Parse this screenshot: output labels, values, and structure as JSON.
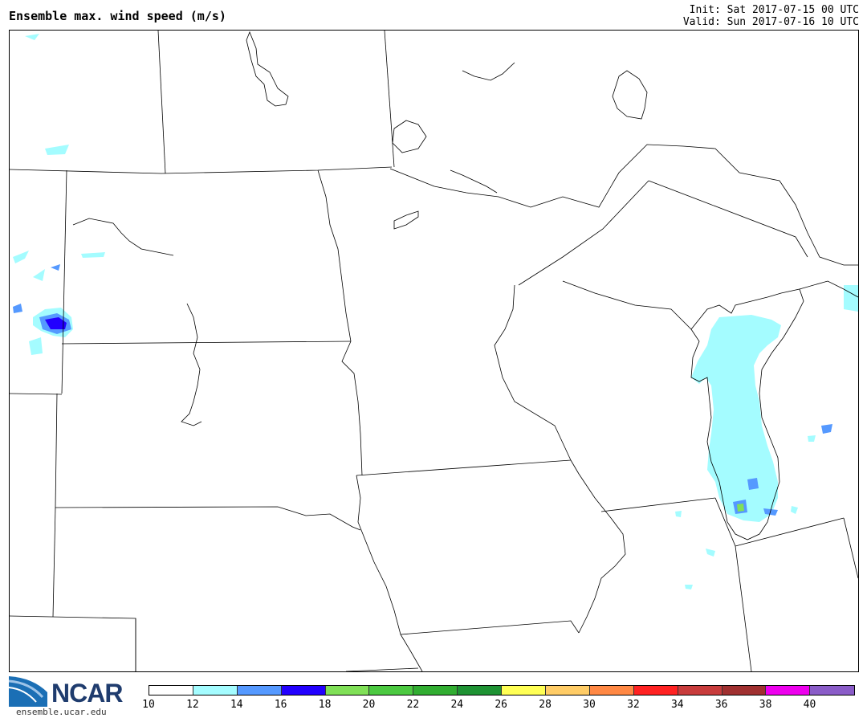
{
  "header": {
    "title": "Ensemble max. wind speed (m/s)",
    "init": "Init: Sat 2017-07-15 00 UTC",
    "valid": "Valid: Sun 2017-07-16 10 UTC"
  },
  "logo": {
    "name": "NCAR",
    "url": "ensemble.ucar.edu"
  },
  "colorbar": {
    "ticks": [
      "10",
      "12",
      "14",
      "16",
      "18",
      "20",
      "22",
      "24",
      "26",
      "28",
      "30",
      "32",
      "34",
      "36",
      "38",
      "40"
    ],
    "colors": [
      "#ffffff",
      "#a4fcff",
      "#5599ff",
      "#2200ff",
      "#80e057",
      "#4cc941",
      "#31ad31",
      "#1e9233",
      "#ffff55",
      "#ffcc66",
      "#ff8844",
      "#ff2222",
      "#c83c3c",
      "#a03030",
      "#ee00ee",
      "#8a5cc8"
    ]
  }
}
